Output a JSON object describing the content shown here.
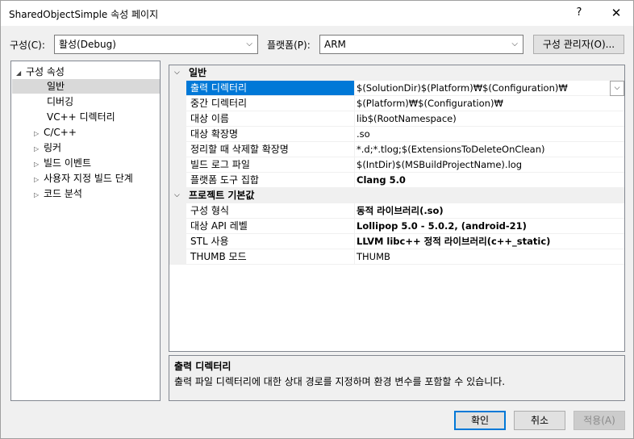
{
  "window": {
    "title": "SharedObjectSimple 속성 페이지",
    "help": "?",
    "close": "✕"
  },
  "toolbar": {
    "config_label": "구성(C):",
    "config_value": "활성(Debug)",
    "platform_label": "플랫폼(P):",
    "platform_value": "ARM",
    "config_manager": "구성 관리자(O)..."
  },
  "tree": {
    "root": "구성 속성",
    "items": [
      "일반",
      "디버깅",
      "VC++ 디렉터리",
      "C/C++",
      "링커",
      "빌드 이벤트",
      "사용자 지정 빌드 단계",
      "코드 분석"
    ],
    "selected": "일반"
  },
  "grid": {
    "categories": [
      {
        "label": "일반",
        "props": [
          {
            "name": "출력 디렉터리",
            "value": "$(SolutionDir)$(Platform)₩$(Configuration)₩",
            "bold": false
          },
          {
            "name": "중간 디렉터리",
            "value": "$(Platform)₩$(Configuration)₩",
            "bold": false
          },
          {
            "name": "대상 이름",
            "value": "lib$(RootNamespace)",
            "bold": false
          },
          {
            "name": "대상 확장명",
            "value": ".so",
            "bold": false
          },
          {
            "name": "정리할 때 삭제할 확장명",
            "value": "*.d;*.tlog;$(ExtensionsToDeleteOnClean)",
            "bold": false
          },
          {
            "name": "빌드 로그 파일",
            "value": "$(IntDir)$(MSBuildProjectName).log",
            "bold": false
          },
          {
            "name": "플랫폼 도구 집합",
            "value": "Clang 5.0",
            "bold": true
          }
        ]
      },
      {
        "label": "프로젝트 기본값",
        "props": [
          {
            "name": "구성 형식",
            "value": "동적 라이브러리(.so)",
            "bold": true
          },
          {
            "name": "대상 API 레벨",
            "value": "Lollipop 5.0 - 5.0.2, (android-21)",
            "bold": true
          },
          {
            "name": "STL 사용",
            "value": "LLVM libc++ 정적 라이브러리(c++_static)",
            "bold": true
          },
          {
            "name": "THUMB 모드",
            "value": "THUMB",
            "bold": false
          }
        ]
      }
    ]
  },
  "description": {
    "title": "출력 디렉터리",
    "text": "출력 파일 디렉터리에 대한 상대 경로를 지정하며 환경 변수를 포함할 수 있습니다."
  },
  "buttons": {
    "ok": "확인",
    "cancel": "취소",
    "apply": "적용(A)"
  }
}
